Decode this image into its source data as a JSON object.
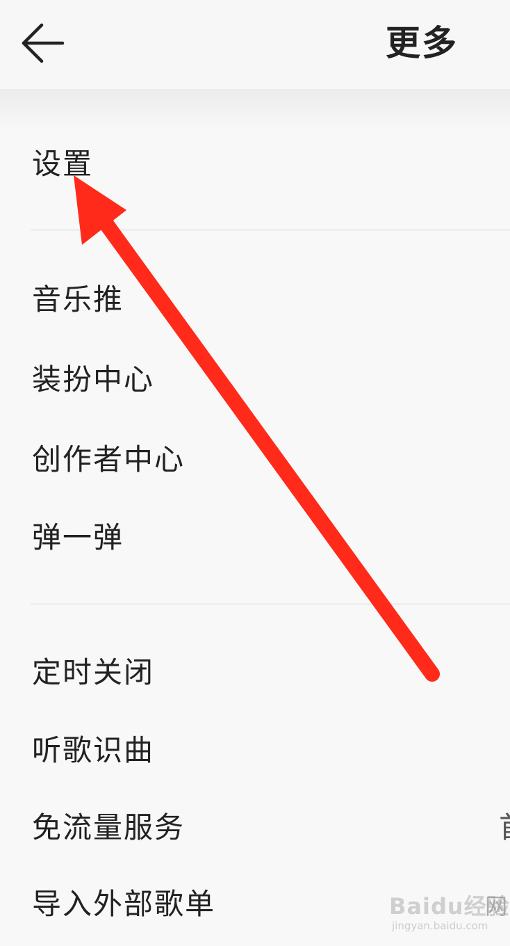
{
  "header": {
    "title": "更多",
    "back_icon": "back-arrow-icon"
  },
  "menu": {
    "groups": [
      {
        "items": [
          "设置"
        ]
      },
      {
        "items": [
          "音乐推",
          "装扮中心",
          "创作者中心",
          "弹一弹"
        ]
      },
      {
        "items": [
          "定时关闭",
          "听歌识曲",
          "免流量服务",
          "导入外部歌单"
        ]
      }
    ],
    "free_data_value_partial": "首"
  },
  "annotation": {
    "arrow_color": "#ff2a1a"
  },
  "watermark": {
    "brand": "Baidu经验",
    "url": "jingyan.baidu.com",
    "cut_char": "网"
  }
}
